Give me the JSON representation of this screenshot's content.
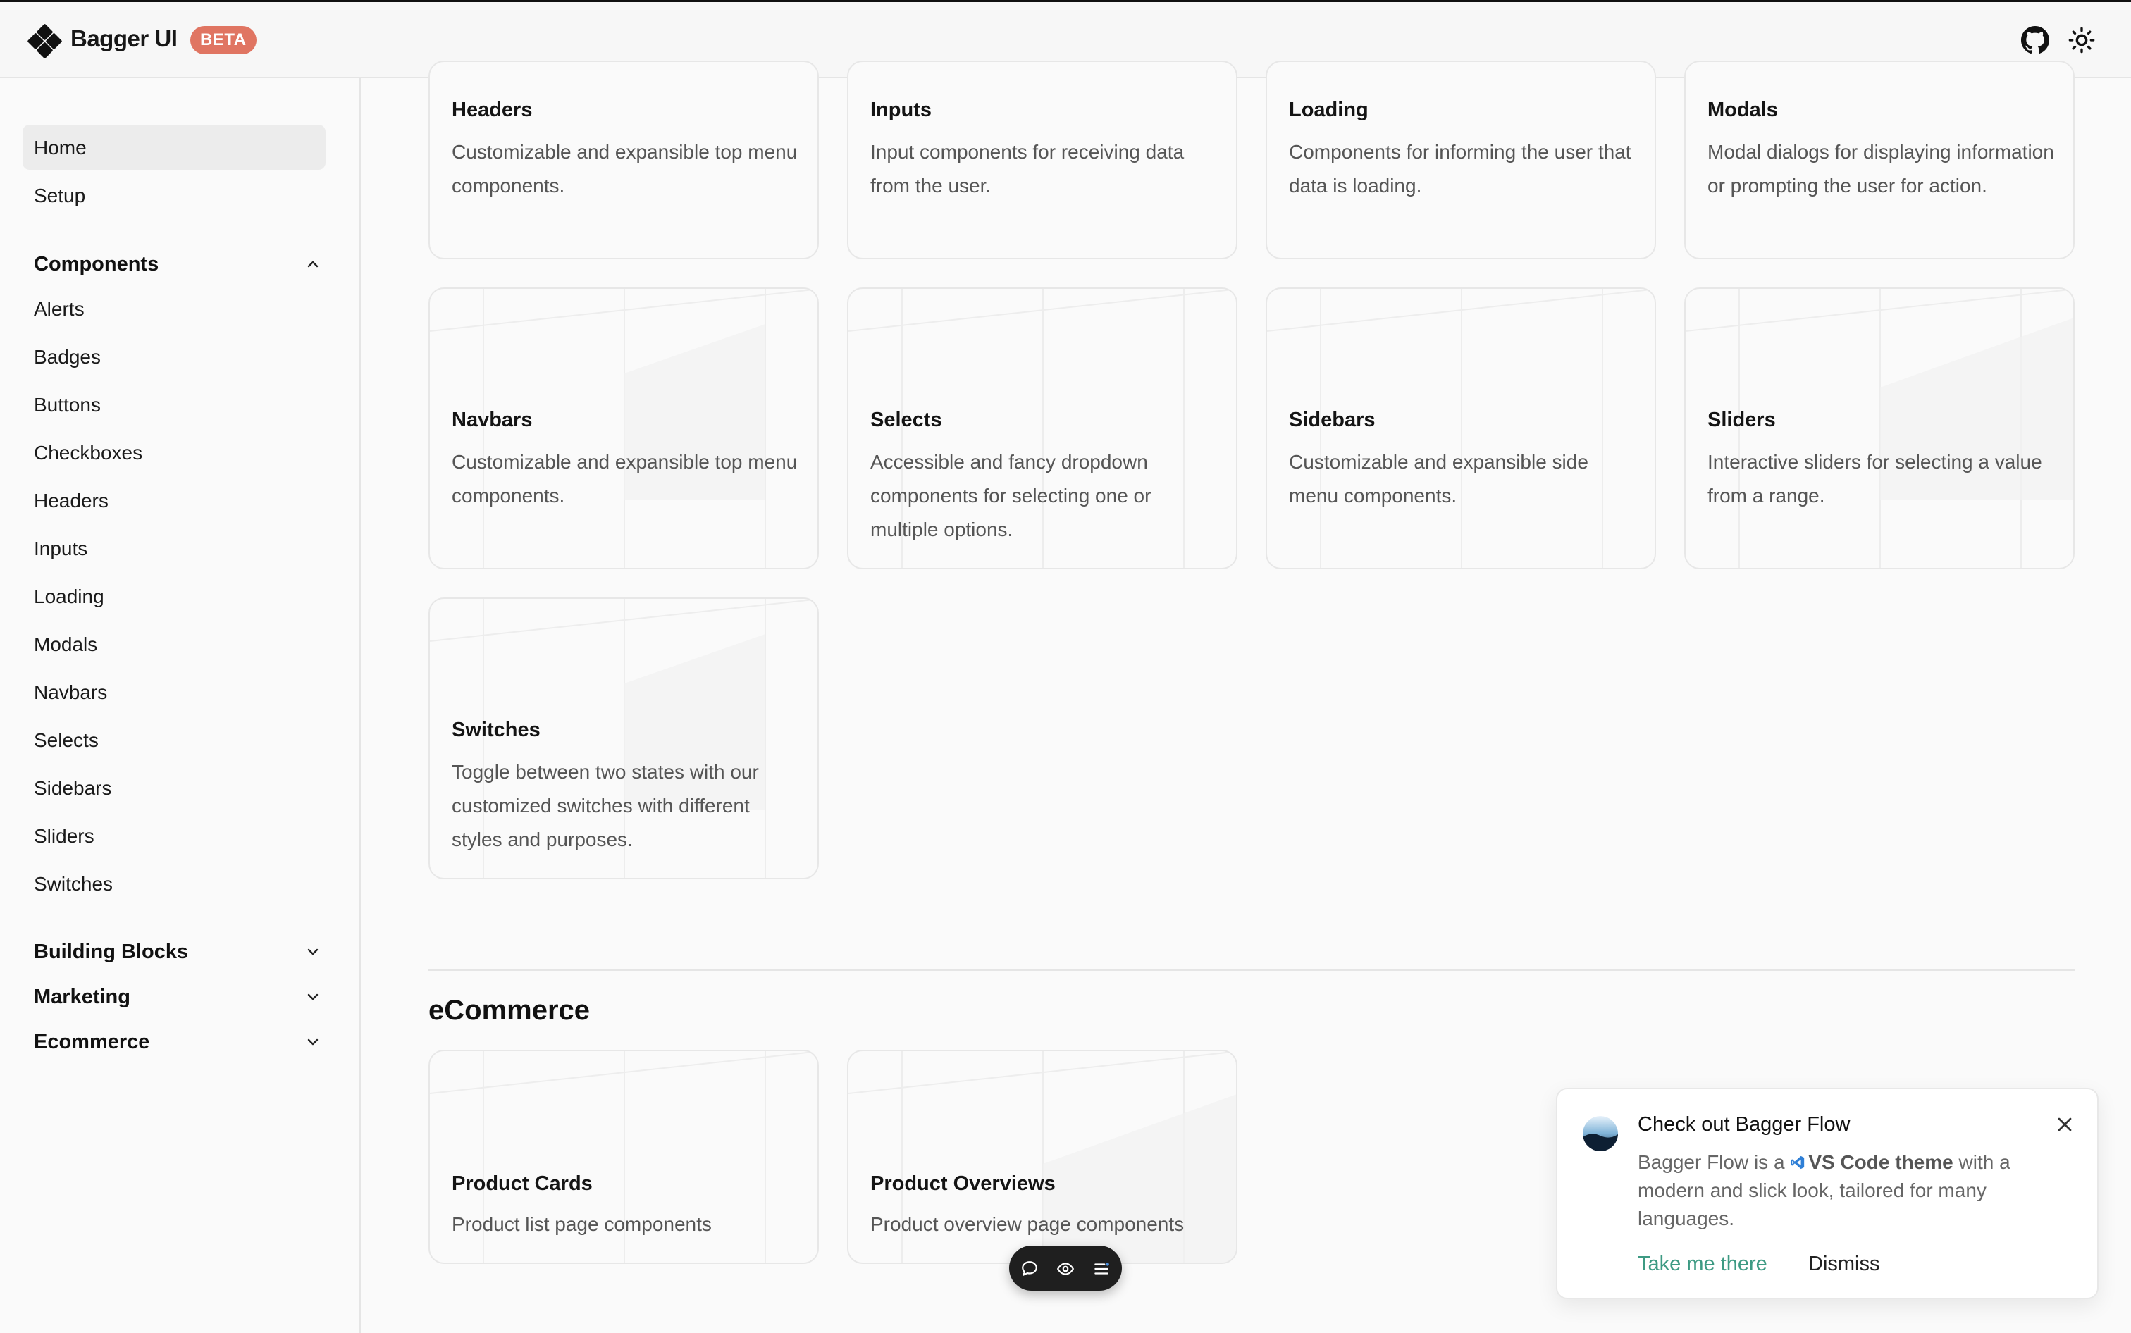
{
  "header": {
    "brand": "Bagger UI",
    "badge": "BETA",
    "icons": [
      "github-icon",
      "sun-icon"
    ]
  },
  "sidebar": {
    "top_items": [
      {
        "label": "Home",
        "active": true
      },
      {
        "label": "Setup",
        "active": false
      }
    ],
    "components": {
      "label": "Components",
      "expanded": true,
      "items": [
        "Alerts",
        "Badges",
        "Buttons",
        "Checkboxes",
        "Headers",
        "Inputs",
        "Loading",
        "Modals",
        "Navbars",
        "Selects",
        "Sidebars",
        "Sliders",
        "Switches"
      ]
    },
    "collapsed_sections": [
      "Building Blocks",
      "Marketing",
      "Ecommerce"
    ]
  },
  "cards": [
    {
      "title": "Headers",
      "description": "Customizable and expansible top menu components."
    },
    {
      "title": "Inputs",
      "description": "Input components for receiving data from the user."
    },
    {
      "title": "Loading",
      "description": "Components for informing the user that data is loading."
    },
    {
      "title": "Modals",
      "description": "Modal dialogs for displaying information or prompting the user for action."
    },
    {
      "title": "Navbars",
      "description": "Customizable and expansible top menu components."
    },
    {
      "title": "Selects",
      "description": "Accessible and fancy dropdown components for selecting one or multiple options."
    },
    {
      "title": "Sidebars",
      "description": "Customizable and expansible side menu components."
    },
    {
      "title": "Sliders",
      "description": "Interactive sliders for selecting a value from a range."
    },
    {
      "title": "Switches",
      "description": "Toggle between two states with our customized switches with different styles and purposes."
    }
  ],
  "ecommerce": {
    "title": "eCommerce",
    "cards": [
      {
        "title": "Product Cards",
        "description": "Product list page components"
      },
      {
        "title": "Product Overviews",
        "description": "Product overview page components"
      }
    ]
  },
  "toolbar": {
    "icons": [
      "comment-icon",
      "eye-icon",
      "menu-icon"
    ]
  },
  "toast": {
    "title": "Check out Bagger Flow",
    "body_prefix": "Bagger Flow is a",
    "body_highlight": "VS Code theme",
    "body_suffix": "with a modern and slick look, tailored for many languages.",
    "primary_action": "Take me there",
    "secondary_action": "Dismiss"
  },
  "colors": {
    "badge": "#e07562",
    "link": "#3d9a83",
    "vscode": "#2f7fd6",
    "active_nav": "#ececec"
  }
}
